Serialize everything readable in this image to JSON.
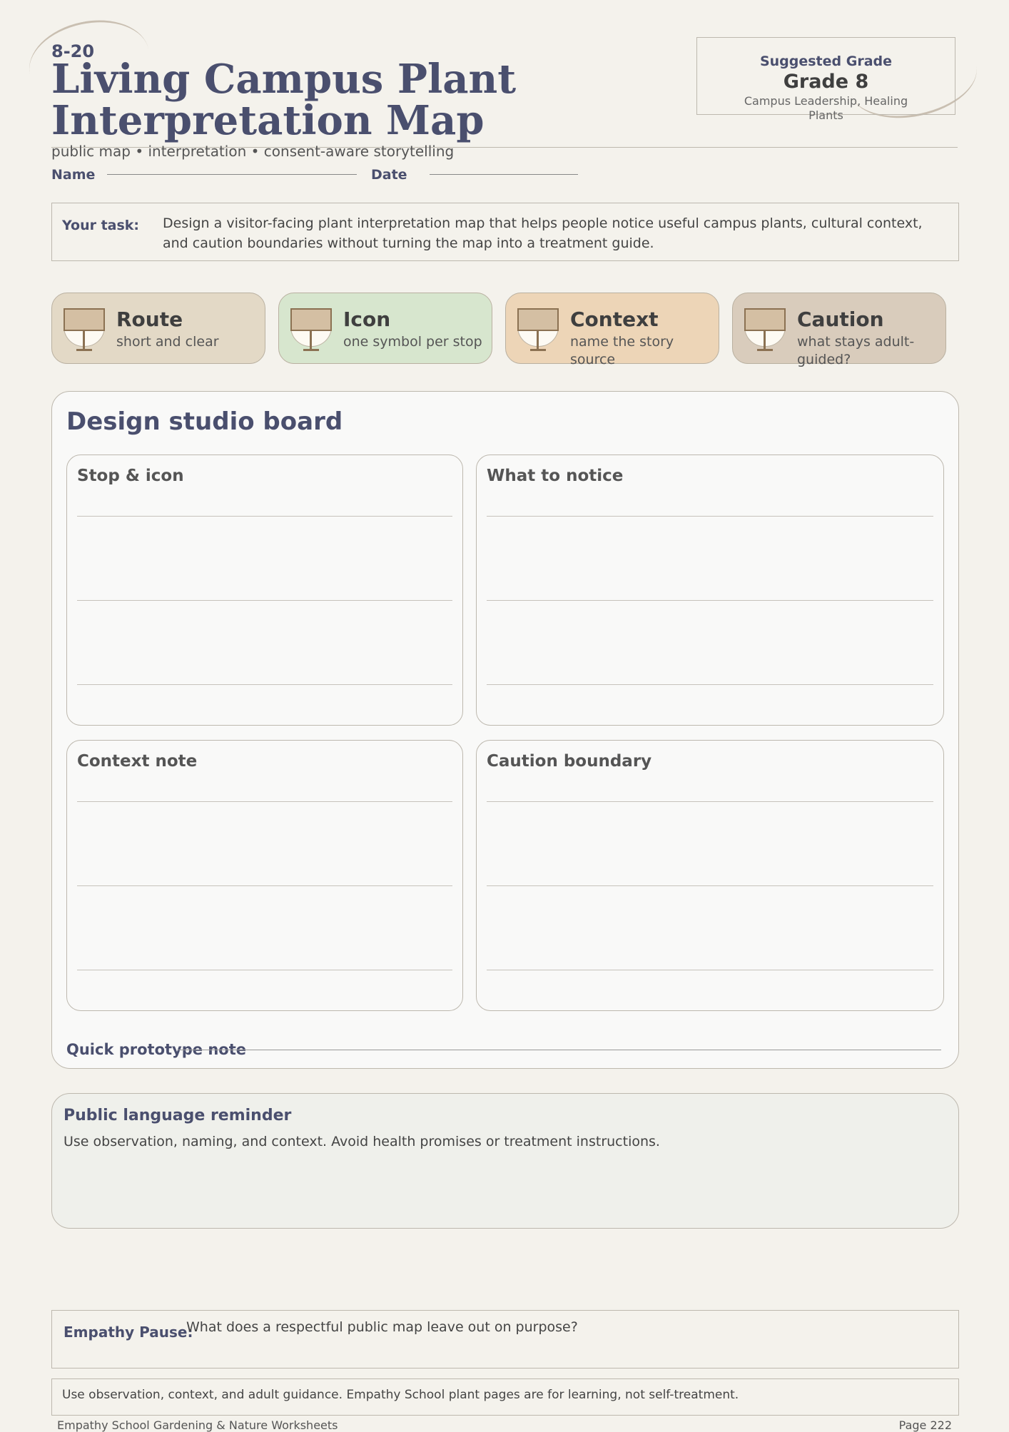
{
  "header": {
    "code": "8-20",
    "title_line1": "Living Campus Plant",
    "title_line2": "Interpretation Map",
    "subtitle": "public map • interpretation • consent-aware storytelling",
    "name_label": "Name",
    "date_label": "Date"
  },
  "grade_box": {
    "label": "Suggested Grade",
    "grade": "Grade 8",
    "strand": "Campus Leadership, Healing Plants"
  },
  "task": {
    "label": "Your task:",
    "text": "Design a visitor-facing plant interpretation map that helps people notice useful campus plants, cultural context, and caution boundaries without turning the map into a treatment guide."
  },
  "cards": [
    {
      "title": "Route",
      "subtitle": "short and clear",
      "color": "#e3d9c6"
    },
    {
      "title": "Icon",
      "subtitle": "one symbol per stop",
      "color": "#d7e6ce"
    },
    {
      "title": "Context",
      "subtitle": "name the story source",
      "color": "#edd5b7"
    },
    {
      "title": "Caution",
      "subtitle": "what stays adult-guided?",
      "color": "#d9ccbc"
    }
  ],
  "studio": {
    "title": "Design studio board",
    "panels": [
      {
        "title": "Stop & icon"
      },
      {
        "title": "What to notice"
      },
      {
        "title": "Context note"
      },
      {
        "title": "Caution boundary"
      }
    ],
    "prototype_label": "Quick prototype note"
  },
  "reminder": {
    "title": "Public language reminder",
    "text": "Use observation, naming, and context. Avoid health promises or treatment instructions."
  },
  "pause": {
    "label": "Empathy Pause:",
    "text": "What does a respectful public map leave out on purpose?"
  },
  "footer": {
    "notice": "Use observation, context, and adult guidance. Empathy School plant pages are for learning, not self-treatment.",
    "series": "Empathy School Gardening & Nature Worksheets",
    "page": "Page 222"
  }
}
